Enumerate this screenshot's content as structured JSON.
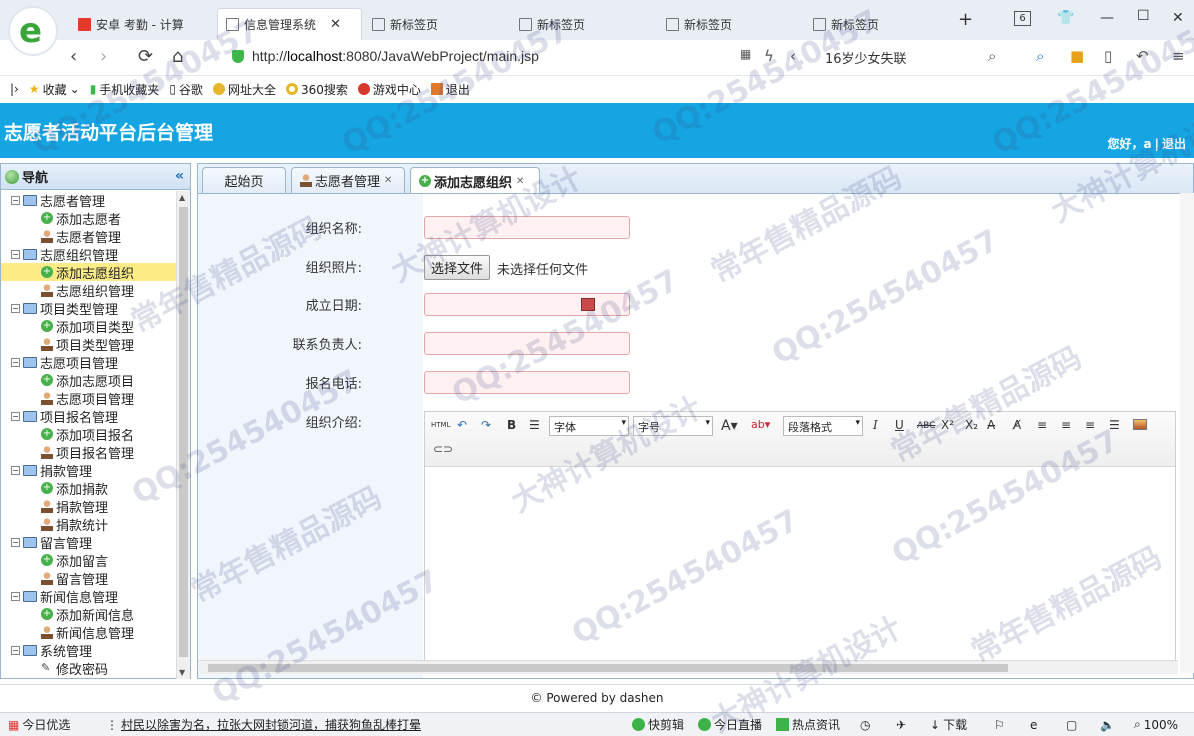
{
  "browser": {
    "tabs": [
      {
        "label": "安卓 考勤 - 计算",
        "icon": "red-square-icon"
      },
      {
        "label": "信息管理系统",
        "icon": "chart-icon",
        "active": true
      },
      {
        "label": "新标签页",
        "icon": "grid-icon"
      },
      {
        "label": "新标签页",
        "icon": "grid-icon"
      },
      {
        "label": "新标签页",
        "icon": "grid-icon"
      },
      {
        "label": "新标签页",
        "icon": "grid-icon"
      }
    ],
    "tab_count": "6",
    "url_prefix": "http://",
    "url_host": "localhost",
    "url_rest": ":8080/JavaWebProject/main.jsp",
    "search_hint": "16岁少女失联",
    "bookmarks": [
      "收藏",
      "手机收藏夹",
      "谷歌",
      "网址大全",
      "360搜索",
      "游戏中心",
      "退出"
    ]
  },
  "app": {
    "title": "志愿者活动平台后台管理",
    "greeting": "您好，a",
    "logout": "退出"
  },
  "nav": {
    "title": "导航",
    "groups": [
      {
        "label": "志愿者管理",
        "items": [
          {
            "label": "添加志愿者",
            "icon": "add"
          },
          {
            "label": "志愿者管理",
            "icon": "user"
          }
        ]
      },
      {
        "label": "志愿组织管理",
        "items": [
          {
            "label": "添加志愿组织",
            "icon": "add",
            "selected": true
          },
          {
            "label": "志愿组织管理",
            "icon": "user"
          }
        ]
      },
      {
        "label": "项目类型管理",
        "items": [
          {
            "label": "添加项目类型",
            "icon": "add"
          },
          {
            "label": "项目类型管理",
            "icon": "user"
          }
        ]
      },
      {
        "label": "志愿项目管理",
        "items": [
          {
            "label": "添加志愿项目",
            "icon": "add"
          },
          {
            "label": "志愿项目管理",
            "icon": "user"
          }
        ]
      },
      {
        "label": "项目报名管理",
        "items": [
          {
            "label": "添加项目报名",
            "icon": "add"
          },
          {
            "label": "项目报名管理",
            "icon": "user"
          }
        ]
      },
      {
        "label": "捐款管理",
        "items": [
          {
            "label": "添加捐款",
            "icon": "add"
          },
          {
            "label": "捐款管理",
            "icon": "user"
          },
          {
            "label": "捐款统计",
            "icon": "user"
          }
        ]
      },
      {
        "label": "留言管理",
        "items": [
          {
            "label": "添加留言",
            "icon": "add"
          },
          {
            "label": "留言管理",
            "icon": "user"
          }
        ]
      },
      {
        "label": "新闻信息管理",
        "items": [
          {
            "label": "添加新闻信息",
            "icon": "add"
          },
          {
            "label": "新闻信息管理",
            "icon": "user"
          }
        ]
      },
      {
        "label": "系统管理",
        "items": [
          {
            "label": "修改密码",
            "icon": "pencil"
          }
        ]
      }
    ]
  },
  "tabs": [
    {
      "label": "起始页"
    },
    {
      "label": "志愿者管理"
    },
    {
      "label": "添加志愿组织",
      "active": true
    }
  ],
  "form": {
    "name_label": "组织名称:",
    "photo_label": "组织照片:",
    "file_button": "选择文件",
    "file_status": "未选择任何文件",
    "date_label": "成立日期:",
    "contact_label": "联系负责人:",
    "phone_label": "报名电话:",
    "intro_label": "组织介绍:"
  },
  "editor": {
    "html_btn": "HTML",
    "font_family": "字体",
    "font_size": "字号",
    "paragraph": "段落格式"
  },
  "footer": "© Powered by dashen",
  "statusbar": {
    "today": "今日优选",
    "news": "村民以除害为名，拉张大网封锁河道，捕获狗鱼乱棒打晕",
    "clip": "快剪辑",
    "live": "今日直播",
    "hot": "热点资讯",
    "download": "下载",
    "zoom": "100%"
  },
  "watermarks": [
    "常年售精品源码",
    "大神计算机设计",
    "QQ:254540457"
  ]
}
